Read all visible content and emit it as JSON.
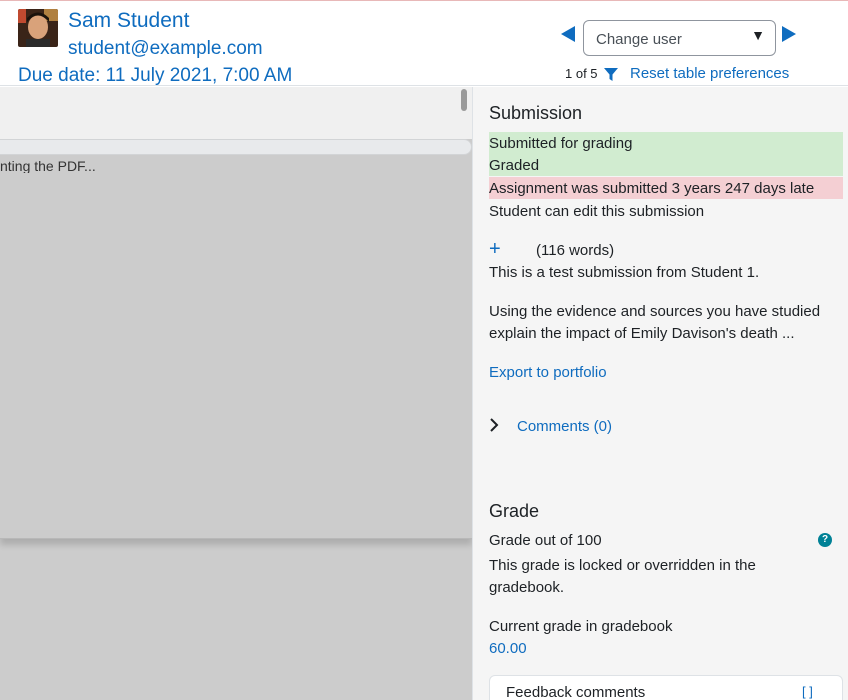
{
  "header": {
    "user_name": "Sam Student",
    "user_email": "student@example.com",
    "due_date": "Due date: 11 July 2021, 7:00 AM",
    "change_user_placeholder": "Change user",
    "count": "1 of 5",
    "reset_link": "Reset table preferences",
    "prev_icon": "triangle-left-icon",
    "next_icon": "triangle-right-icon",
    "filter_icon": "funnel-icon"
  },
  "pdf_viewer": {
    "loading_text": "nting the PDF..."
  },
  "submission": {
    "title": "Submission",
    "status_submitted": "Submitted for grading",
    "status_graded": "Graded",
    "status_late": "Assignment was submitted 3 years 247 days late",
    "editable_note": "Student can edit this submission",
    "word_count": "(116 words)",
    "text_line1": "This is a test submission from Student 1.",
    "text_line2": "Using the evidence and sources you have studied",
    "text_line3": "explain the impact of Emily Davison's death ...",
    "export_link": "Export to portfolio",
    "comments_link": "Comments (0)"
  },
  "grade": {
    "title": "Grade",
    "grade_out_of": "Grade out of 100",
    "locked_line1": "This grade is locked or overridden in the",
    "locked_line2": "gradebook.",
    "current_label": "Current grade in gradebook",
    "current_value": "60.00",
    "feedback_label": "Feedback comments"
  },
  "colors": {
    "link": "#0f6cbf",
    "status_green": "#d1ecd0",
    "status_red": "#f4cfd3",
    "help": "#008196"
  }
}
